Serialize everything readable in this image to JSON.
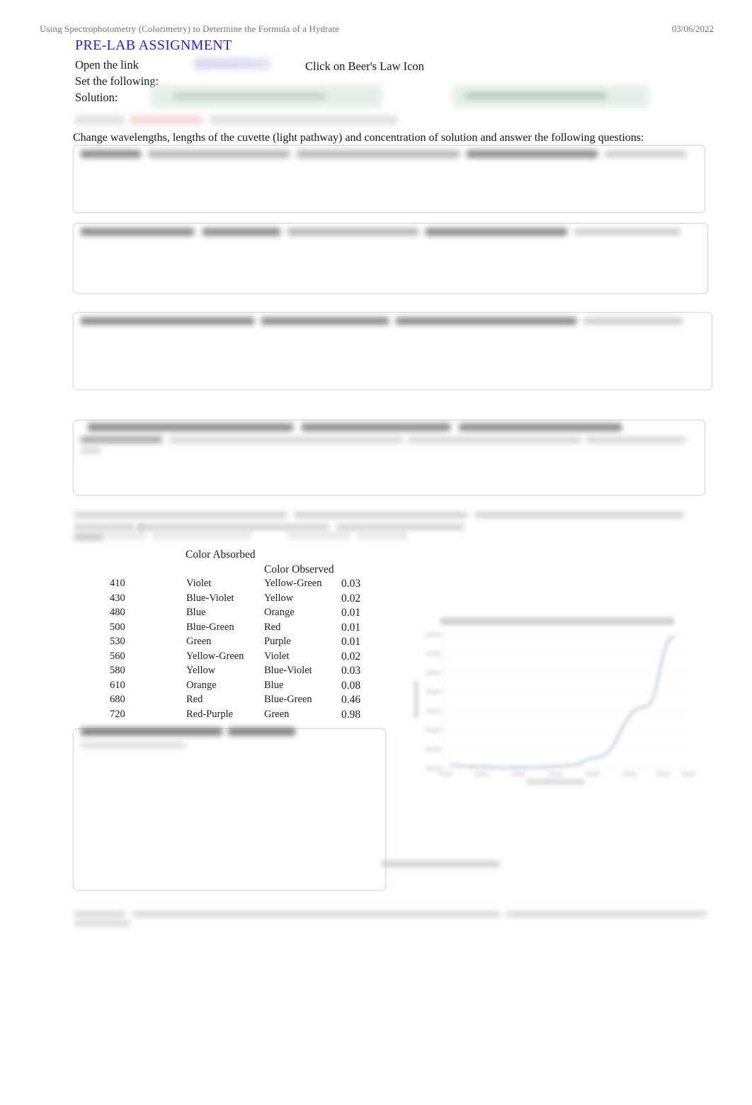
{
  "header": {
    "document_title": "Using Spectrophotometry (Colorimetry) to Determine the Formula of a Hydrate",
    "date": "03/06/2022"
  },
  "body": {
    "section_title": "PRE-LAB ASSIGNMENT",
    "open_the_link_label": "Open the link",
    "set_the_following_label": "Set the following:",
    "solution_label": "Solution:",
    "beers_law_label": "Click on Beer's Law Icon",
    "instruction": "Change wavelengths, lengths of the cuvette (light pathway) and concentration of solution and answer the following questions:"
  },
  "table": {
    "col_wavelength_header": "",
    "col_absorbed_header": "Color Absorbed",
    "col_observed_header": "Color Observed",
    "col_value_header": "",
    "rows": [
      {
        "wavelength": "410",
        "absorbed": "Violet",
        "observed": "Yellow-Green",
        "value": "0.03"
      },
      {
        "wavelength": "430",
        "absorbed": "Blue-Violet",
        "observed": "Yellow",
        "value": "0.02"
      },
      {
        "wavelength": "480",
        "absorbed": "Blue",
        "observed": "Orange",
        "value": "0.01"
      },
      {
        "wavelength": "500",
        "absorbed": "Blue-Green",
        "observed": "Red",
        "value": "0.01"
      },
      {
        "wavelength": "530",
        "absorbed": "Green",
        "observed": "Purple",
        "value": "0.01"
      },
      {
        "wavelength": "560",
        "absorbed": "Yellow-Green",
        "observed": "Violet",
        "value": "0.02"
      },
      {
        "wavelength": "580",
        "absorbed": "Yellow",
        "observed": "Blue-Violet",
        "value": "0.03"
      },
      {
        "wavelength": "610",
        "absorbed": "Orange",
        "observed": "Blue",
        "value": "0.08"
      },
      {
        "wavelength": "680",
        "absorbed": "Red",
        "observed": "Blue-Green",
        "value": "0.46"
      },
      {
        "wavelength": "720",
        "absorbed": "Red-Purple",
        "observed": "Green",
        "value": "0.98"
      }
    ]
  },
  "chart_data": {
    "type": "line",
    "title": "",
    "xlabel": "",
    "ylabel": "",
    "x": [
      410,
      430,
      480,
      500,
      530,
      560,
      580,
      610,
      680,
      720
    ],
    "values": [
      0.03,
      0.02,
      0.01,
      0.01,
      0.01,
      0.02,
      0.03,
      0.08,
      0.46,
      0.98
    ],
    "xlim": [
      400,
      740
    ],
    "ylim": [
      0,
      1.0
    ],
    "grid": true,
    "legend": []
  },
  "colors": {
    "heading": "#2121d6",
    "header_text": "#767676",
    "box_border": "#e8d6d4",
    "highlight_green": "#dfeee4",
    "highlight_link": "#cfd1ea",
    "chart_line": "#8ba9c4"
  }
}
